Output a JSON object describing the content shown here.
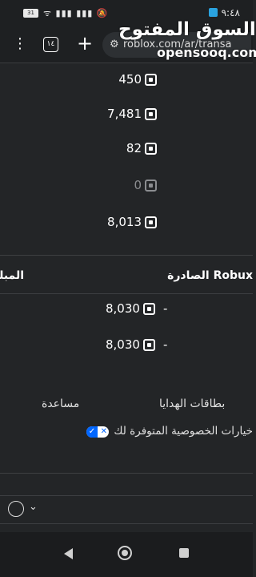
{
  "status_bar": {
    "time": "٩:٤٨",
    "icons_text": "ᯤ ▮▮▮ ▮▮▮ 🔕",
    "battery": "31"
  },
  "browser": {
    "tabs_count": "١٤",
    "url": "roblox.com/ar/transa",
    "menu_glyph": "⋮",
    "plus_glyph": "+"
  },
  "watermark": {
    "arabic": "السوق المفتوح",
    "latin": "opensooq.com"
  },
  "balances": [
    {
      "value": "450"
    },
    {
      "value": "7,481"
    },
    {
      "value": "82"
    },
    {
      "value": "0"
    },
    {
      "value": "8,013"
    }
  ],
  "columns": {
    "outgoing_header": "Robux الصادرة",
    "amount_header": "المبلغ"
  },
  "outgoing": [
    {
      "sign": "-",
      "value": "8,030"
    },
    {
      "sign": "-",
      "value": "8,030"
    }
  ],
  "footer": {
    "gift_cards": "بطاقات الهدايا",
    "help": "مساعدة",
    "privacy": "خيارات الخصوصية المتوفرة لك"
  },
  "icons": [
    "robux-icon",
    "globe-icon",
    "chevron-down-icon",
    "back-icon",
    "home-icon",
    "recents-icon",
    "tabs-icon",
    "menu-icon"
  ]
}
